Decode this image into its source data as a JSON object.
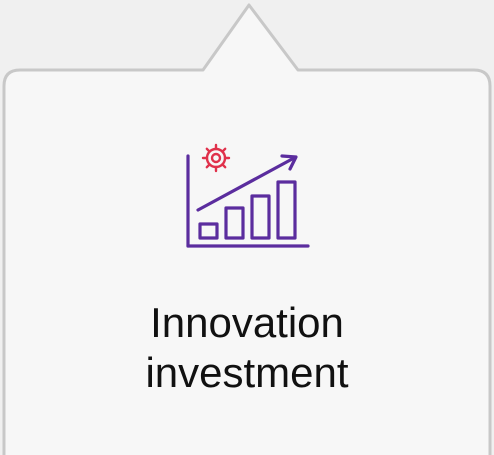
{
  "card": {
    "icon": "growth-chart-with-gear-icon",
    "label_line1": "Innovation",
    "label_line2": "investment"
  },
  "colors": {
    "page_bg": "#f0f0f0",
    "card_bg": "#f7f7f7",
    "card_border": "#c8c8c8",
    "chart_stroke": "#5b2d9e",
    "gear_stroke": "#e0314b",
    "text": "#111111"
  }
}
